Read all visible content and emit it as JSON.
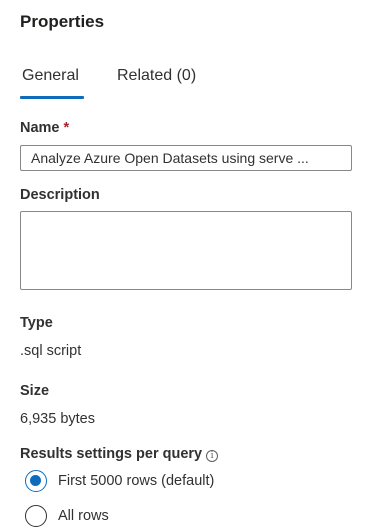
{
  "panel": {
    "title": "Properties"
  },
  "tabs": [
    {
      "label": "General",
      "selected": true
    },
    {
      "label": "Related (0)",
      "selected": false
    }
  ],
  "fields": {
    "name": {
      "label": "Name",
      "required_marker": "*",
      "value": "Analyze Azure Open Datasets using serve ..."
    },
    "description": {
      "label": "Description",
      "value": ""
    },
    "type": {
      "label": "Type",
      "value": ".sql script"
    },
    "size": {
      "label": "Size",
      "value": "6,935 bytes"
    }
  },
  "results_settings": {
    "label": "Results settings per query",
    "info_icon": "info-icon",
    "options": [
      {
        "label": "First 5000 rows (default)",
        "checked": true
      },
      {
        "label": "All rows",
        "checked": false
      }
    ]
  },
  "colors": {
    "accent": "#0f6cbd",
    "required": "#a4262c"
  }
}
